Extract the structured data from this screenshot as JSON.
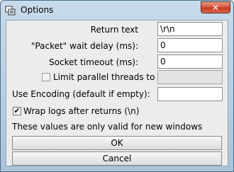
{
  "window": {
    "title": "Options",
    "close_glyph": "✕"
  },
  "fields": [
    {
      "label": "Return text",
      "value": "\\r\\n"
    },
    {
      "label": "\"Packet\" wait delay (ms):",
      "value": "0"
    },
    {
      "label": "Socket timeout (ms):",
      "value": "0"
    },
    {
      "label": "Limit parallel threads to",
      "value": "",
      "checked": false,
      "disabled": true
    },
    {
      "label": "Use Encoding (default if empty):",
      "value": ""
    }
  ],
  "wrap_logs": {
    "label": "Wrap logs after returns (\\n)",
    "checked": true,
    "check_glyph": "✔"
  },
  "note": "These values are only valid for new windows",
  "buttons": {
    "ok": "OK",
    "cancel": "Cancel"
  }
}
